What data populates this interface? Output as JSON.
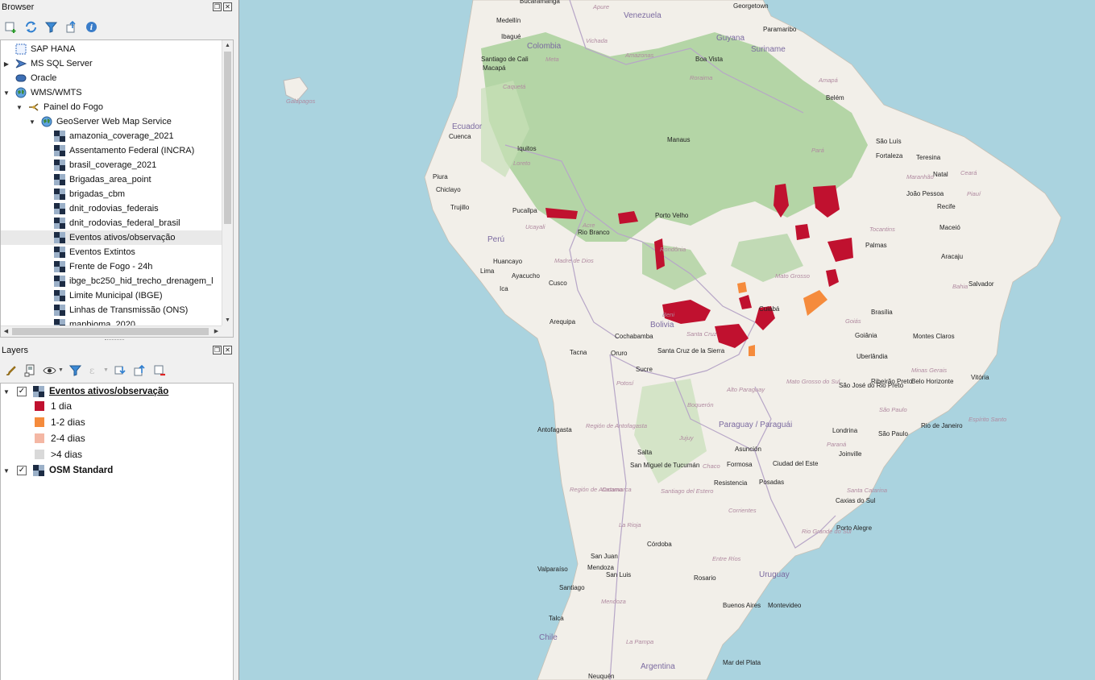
{
  "browser": {
    "title": "Browser",
    "items": [
      {
        "label": "SAP HANA",
        "icon": "sap-hana-icon"
      },
      {
        "label": "MS SQL Server",
        "icon": "mssql-icon"
      },
      {
        "label": "Oracle",
        "icon": "oracle-icon"
      },
      {
        "label": "WMS/WMTS",
        "icon": "globe-icon"
      },
      {
        "label": "Painel do Fogo",
        "icon": "connection-icon"
      },
      {
        "label": "GeoServer Web Map Service",
        "icon": "globe-icon"
      },
      {
        "label": "amazonia_coverage_2021",
        "icon": "raster-layer-icon"
      },
      {
        "label": "Assentamento Federal (INCRA)",
        "icon": "raster-layer-icon"
      },
      {
        "label": "brasil_coverage_2021",
        "icon": "raster-layer-icon"
      },
      {
        "label": "Brigadas_area_point",
        "icon": "raster-layer-icon"
      },
      {
        "label": "brigadas_cbm",
        "icon": "raster-layer-icon"
      },
      {
        "label": "dnit_rodovias_federais",
        "icon": "raster-layer-icon"
      },
      {
        "label": "dnit_rodovias_federal_brasil",
        "icon": "raster-layer-icon"
      },
      {
        "label": "Eventos ativos/observação",
        "icon": "raster-layer-icon"
      },
      {
        "label": "Eventos Extintos",
        "icon": "raster-layer-icon"
      },
      {
        "label": "Frente de Fogo - 24h",
        "icon": "raster-layer-icon"
      },
      {
        "label": "ibge_bc250_hid_trecho_drenagem_l",
        "icon": "raster-layer-icon"
      },
      {
        "label": "Limite Municipal (IBGE)",
        "icon": "raster-layer-icon"
      },
      {
        "label": "Linhas de Transmissão (ONS)",
        "icon": "raster-layer-icon"
      },
      {
        "label": "mapbioma_2020",
        "icon": "raster-layer-icon"
      }
    ]
  },
  "layers": {
    "title": "Layers",
    "active_layer": "Eventos ativos/observação",
    "legend": [
      {
        "label": "1 dia",
        "color": "#c0112f"
      },
      {
        "label": "1-2 dias",
        "color": "#f58b3c"
      },
      {
        "label": "2-4 dias",
        "color": "#f4b7a4"
      },
      {
        "label": ">4 dias",
        "color": "#d9d9d9"
      }
    ],
    "base_layer": "OSM Standard"
  },
  "map": {
    "countries": [
      "Venezuela",
      "Guyana",
      "Suriname",
      "Colombia",
      "Ecuador",
      "Perú",
      "Bolivia",
      "Chile",
      "Paraguay / Paraguái",
      "Uruguay",
      "Argentina"
    ],
    "cities": [
      "Bucaramanga",
      "Georgetown",
      "Paramaribo",
      "Medellín",
      "Ibagué",
      "Boa Vista",
      "Santiago de Cali",
      "Macapá",
      "Belém",
      "São Luís",
      "Fortaleza",
      "Teresina",
      "Natal",
      "João Pessoa",
      "Recife",
      "Maceió",
      "Aracaju",
      "Salvador",
      "Manaus",
      "Iquitos",
      "Cuenca",
      "Piura",
      "Chiclayo",
      "Trujillo",
      "Pucallpa",
      "Porto Velho",
      "Rio Branco",
      "Palmas",
      "Lima",
      "Huancayo",
      "Ayacucho",
      "Ica",
      "Cusco",
      "Arequipa",
      "Cuiabá",
      "Brasília",
      "Goiânia",
      "Montes Claros",
      "Uberlândia",
      "Cochabamba",
      "Santa Cruz de la Sierra",
      "Tacna",
      "Oruro",
      "Sucre",
      "Ribeirão Preto",
      "Belo Horizonte",
      "Vitória",
      "São José do Rio Preto",
      "Rio de Janeiro",
      "São Paulo",
      "Londrina",
      "Antofagasta",
      "Salta",
      "Asunción",
      "San Miguel de Tucumán",
      "Formosa",
      "Ciudad del Este",
      "Posadas",
      "Resistencia",
      "Joinville",
      "Caxias do Sul",
      "Porto Alegre",
      "Córdoba",
      "San Juan",
      "Mendoza",
      "San Luis",
      "Rosario",
      "Valparaíso",
      "Santiago",
      "Buenos Aires",
      "Montevideo",
      "Talca",
      "Mar del Plata",
      "Neuquén"
    ],
    "states": [
      "Amazonas",
      "Roraima",
      "Amapá",
      "Pará",
      "Maranhão",
      "Ceará",
      "Piauí",
      "Tocantins",
      "Bahia",
      "Rondônia",
      "Mato Grosso",
      "Goiás",
      "Minas Gerais",
      "Madre de Dios",
      "Ucayali",
      "Loreto",
      "Meta",
      "Vichada",
      "Caquetá",
      "Apure",
      "Acre",
      "Beni",
      "Santa Cruz",
      "Potosí",
      "Mato Grosso do Sul",
      "São Paulo",
      "Paraná",
      "Santa Catarina",
      "Rio Grande do Sul",
      "Espírito Santo",
      "Alto Paraguay",
      "Boquerón",
      "Chaco",
      "Corrientes",
      "Entre Ríos",
      "Santiago del Estero",
      "Catamarca",
      "La Rioja",
      "Mendoza",
      "La Pampa",
      "Región de Antofagasta",
      "Región de Atacama",
      "Jujuy",
      "Galápagos"
    ]
  }
}
